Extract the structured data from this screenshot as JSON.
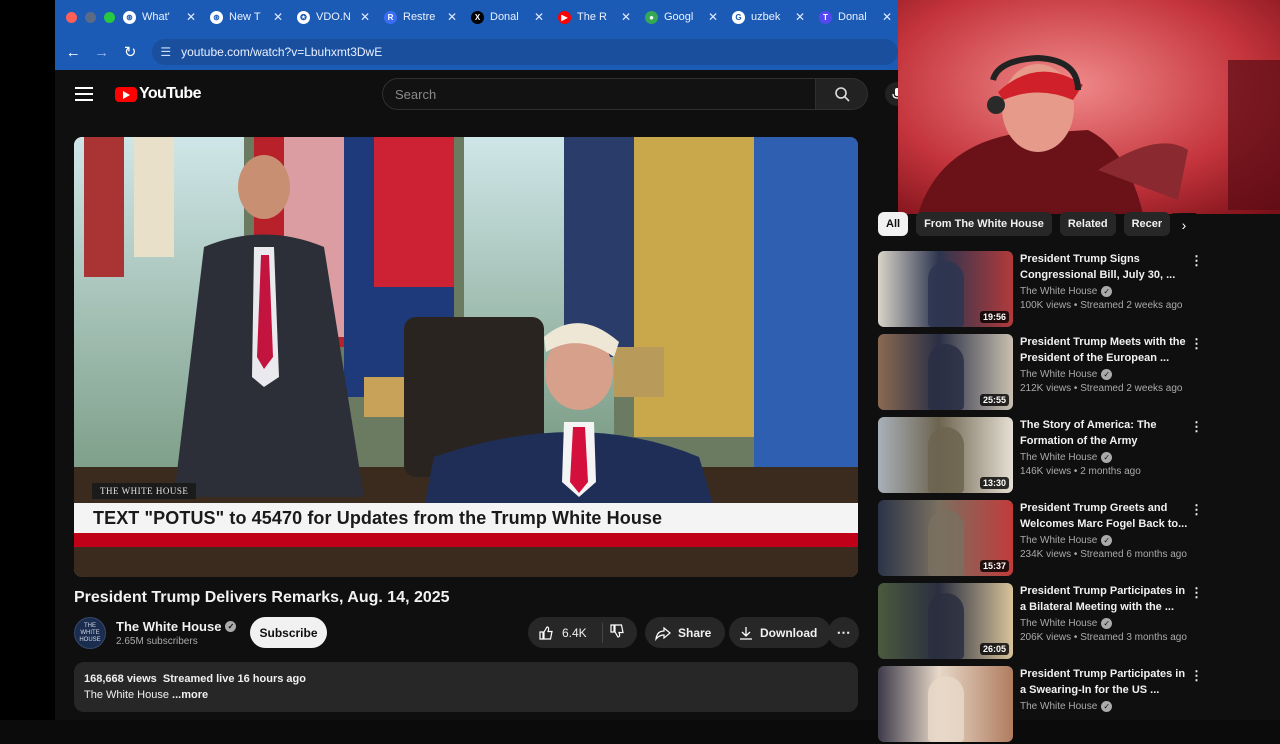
{
  "browser": {
    "traffic_colors": [
      "#ff5f57",
      "#5b6b86",
      "#28c840"
    ],
    "tabs": [
      {
        "label": "What'",
        "icon": "chatgpt-icon"
      },
      {
        "label": "New T",
        "icon": "chatgpt-icon"
      },
      {
        "label": "VDO.N",
        "icon": "vdo-ninja-icon"
      },
      {
        "label": "Restre",
        "icon": "restream-icon"
      },
      {
        "label": "Donal",
        "icon": "x-icon"
      },
      {
        "label": "The R",
        "icon": "youtube-icon"
      },
      {
        "label": "Googl",
        "icon": "google-maps-icon"
      },
      {
        "label": "uzbek",
        "icon": "google-icon"
      },
      {
        "label": "Donal",
        "icon": "truth-social-icon"
      }
    ],
    "url": "youtube.com/watch?v=Lbuhxmt3DwE"
  },
  "youtube": {
    "logo_text": "YouTube",
    "search_placeholder": "Search"
  },
  "video": {
    "overlay_badge": "THE WHITE HOUSE",
    "banner_text": "TEXT \"POTUS\" to 45470 for Updates from the Trump White House",
    "title": "President Trump Delivers Remarks, Aug. 14, 2025",
    "channel_name": "The White House",
    "channel_avatar_text": "THE WHITE HOUSE",
    "subscribers": "2.65M subscribers",
    "subscribe_label": "Subscribe",
    "likes": "6.4K",
    "share_label": "Share",
    "download_label": "Download",
    "description": {
      "views": "168,668 views",
      "streamed": "Streamed live 16 hours ago",
      "text": "The White House",
      "more": "...more"
    }
  },
  "sidebar": {
    "chips": [
      {
        "label": "All",
        "active": true
      },
      {
        "label": "From The White House",
        "active": false
      },
      {
        "label": "Related",
        "active": false
      },
      {
        "label": "Recer",
        "active": false
      }
    ],
    "items": [
      {
        "title": "President Trump Signs Congressional Bill, July 30, ...",
        "channel": "The White House",
        "meta": "100K views • Streamed 2 weeks ago",
        "duration": "19:56"
      },
      {
        "title": "President Trump Meets with the President of the European ...",
        "channel": "The White House",
        "meta": "212K views • Streamed 2 weeks ago",
        "duration": "25:55"
      },
      {
        "title": "The Story of America: The Formation of the Army",
        "channel": "The White House",
        "meta": "146K views • 2 months ago",
        "duration": "13:30"
      },
      {
        "title": "President Trump Greets and Welcomes Marc Fogel Back to...",
        "channel": "The White House",
        "meta": "234K views • Streamed 6 months ago",
        "duration": "15:37"
      },
      {
        "title": "President Trump Participates in a Bilateral Meeting with the ...",
        "channel": "The White House",
        "meta": "206K views • Streamed 3 months ago",
        "duration": "26:05"
      },
      {
        "title": "President Trump Participates in a Swearing-In for the US ...",
        "channel": "The White House",
        "meta": "",
        "duration": ""
      }
    ]
  }
}
